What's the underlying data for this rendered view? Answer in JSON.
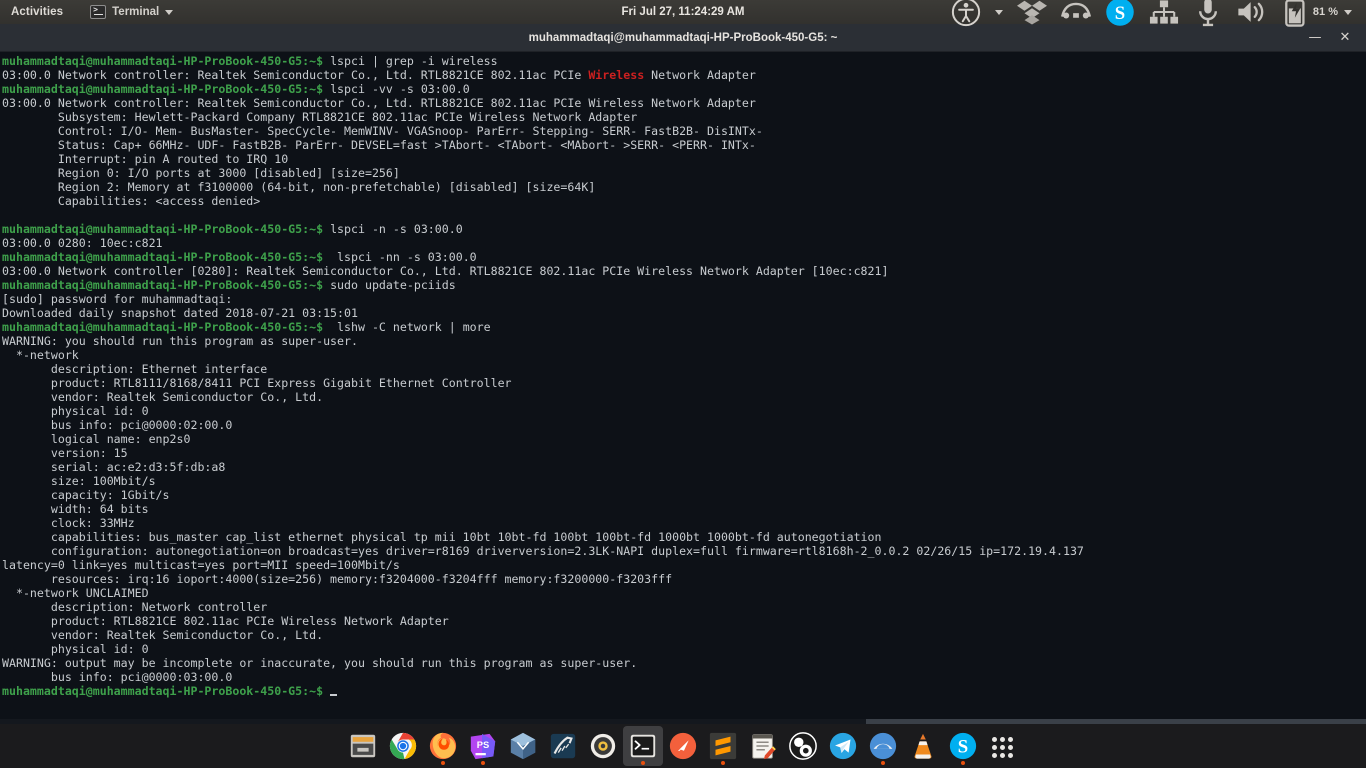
{
  "topbar": {
    "activities": "Activities",
    "app_name": "Terminal",
    "app_icon": "terminal-icon",
    "clock": "Fri Jul 27, 11:24:29 AM",
    "indicators": [
      {
        "name": "accessibility-icon",
        "label": ""
      },
      {
        "name": "chevron-down-icon",
        "label": ""
      },
      {
        "name": "dropbox-icon",
        "label": ""
      },
      {
        "name": "vpn-icon",
        "label": ""
      },
      {
        "name": "skype-tray-icon",
        "label": ""
      },
      {
        "name": "network-wired-icon",
        "label": ""
      },
      {
        "name": "microphone-icon",
        "label": ""
      },
      {
        "name": "volume-icon",
        "label": ""
      },
      {
        "name": "battery-icon",
        "label": ""
      }
    ],
    "battery_percent": "81 %"
  },
  "window": {
    "title": "muhammadtaqi@muhammadtaqi-HP-ProBook-450-G5: ~",
    "minimize_label": "—",
    "close_label": "✕"
  },
  "terminal": {
    "prompt": "muhammadtaqi@muhammadtaqi-HP-ProBook-450-G5:~$",
    "colors": {
      "background": "#0d1117",
      "foreground": "#c8ccd0",
      "prompt_green": "#3ea14b",
      "match_red": "#cc2020"
    },
    "lines": [
      {
        "type": "prompt",
        "cmd": " lspci | grep -i wireless"
      },
      {
        "type": "match",
        "pre": "03:00.0 Network controller: Realtek Semiconductor Co., Ltd. RTL8821CE 802.11ac PCIe ",
        "hit": "Wireless",
        "post": " Network Adapter"
      },
      {
        "type": "prompt",
        "cmd": " lspci -vv -s 03:00.0"
      },
      {
        "type": "out",
        "text": "03:00.0 Network controller: Realtek Semiconductor Co., Ltd. RTL8821CE 802.11ac PCIe Wireless Network Adapter"
      },
      {
        "type": "out",
        "text": "        Subsystem: Hewlett-Packard Company RTL8821CE 802.11ac PCIe Wireless Network Adapter"
      },
      {
        "type": "out",
        "text": "        Control: I/O- Mem- BusMaster- SpecCycle- MemWINV- VGASnoop- ParErr- Stepping- SERR- FastB2B- DisINTx-"
      },
      {
        "type": "out",
        "text": "        Status: Cap+ 66MHz- UDF- FastB2B- ParErr- DEVSEL=fast >TAbort- <TAbort- <MAbort- >SERR- <PERR- INTx-"
      },
      {
        "type": "out",
        "text": "        Interrupt: pin A routed to IRQ 10"
      },
      {
        "type": "out",
        "text": "        Region 0: I/O ports at 3000 [disabled] [size=256]"
      },
      {
        "type": "out",
        "text": "        Region 2: Memory at f3100000 (64-bit, non-prefetchable) [disabled] [size=64K]"
      },
      {
        "type": "out",
        "text": "        Capabilities: <access denied>"
      },
      {
        "type": "out",
        "text": ""
      },
      {
        "type": "prompt",
        "cmd": " lspci -n -s 03:00.0"
      },
      {
        "type": "out",
        "text": "03:00.0 0280: 10ec:c821"
      },
      {
        "type": "prompt",
        "cmd": "  lspci -nn -s 03:00.0"
      },
      {
        "type": "out",
        "text": "03:00.0 Network controller [0280]: Realtek Semiconductor Co., Ltd. RTL8821CE 802.11ac PCIe Wireless Network Adapter [10ec:c821]"
      },
      {
        "type": "prompt",
        "cmd": " sudo update-pciids"
      },
      {
        "type": "out",
        "text": "[sudo] password for muhammadtaqi:"
      },
      {
        "type": "out",
        "text": "Downloaded daily snapshot dated 2018-07-21 03:15:01"
      },
      {
        "type": "prompt",
        "cmd": "  lshw -C network | more"
      },
      {
        "type": "out",
        "text": "WARNING: you should run this program as super-user."
      },
      {
        "type": "out",
        "text": "  *-network"
      },
      {
        "type": "out",
        "text": "       description: Ethernet interface"
      },
      {
        "type": "out",
        "text": "       product: RTL8111/8168/8411 PCI Express Gigabit Ethernet Controller"
      },
      {
        "type": "out",
        "text": "       vendor: Realtek Semiconductor Co., Ltd."
      },
      {
        "type": "out",
        "text": "       physical id: 0"
      },
      {
        "type": "out",
        "text": "       bus info: pci@0000:02:00.0"
      },
      {
        "type": "out",
        "text": "       logical name: enp2s0"
      },
      {
        "type": "out",
        "text": "       version: 15"
      },
      {
        "type": "out",
        "text": "       serial: ac:e2:d3:5f:db:a8"
      },
      {
        "type": "out",
        "text": "       size: 100Mbit/s"
      },
      {
        "type": "out",
        "text": "       capacity: 1Gbit/s"
      },
      {
        "type": "out",
        "text": "       width: 64 bits"
      },
      {
        "type": "out",
        "text": "       clock: 33MHz"
      },
      {
        "type": "out",
        "text": "       capabilities: bus_master cap_list ethernet physical tp mii 10bt 10bt-fd 100bt 100bt-fd 1000bt 1000bt-fd autonegotiation"
      },
      {
        "type": "out",
        "text": "       configuration: autonegotiation=on broadcast=yes driver=r8169 driverversion=2.3LK-NAPI duplex=full firmware=rtl8168h-2_0.0.2 02/26/15 ip=172.19.4.137"
      },
      {
        "type": "out",
        "text": "latency=0 link=yes multicast=yes port=MII speed=100Mbit/s"
      },
      {
        "type": "out",
        "text": "       resources: irq:16 ioport:4000(size=256) memory:f3204000-f3204fff memory:f3200000-f3203fff"
      },
      {
        "type": "out",
        "text": "  *-network UNCLAIMED"
      },
      {
        "type": "out",
        "text": "       description: Network controller"
      },
      {
        "type": "out",
        "text": "       product: RTL8821CE 802.11ac PCIe Wireless Network Adapter"
      },
      {
        "type": "out",
        "text": "       vendor: Realtek Semiconductor Co., Ltd."
      },
      {
        "type": "out",
        "text": "       physical id: 0"
      },
      {
        "type": "out",
        "text": "WARNING: output may be incomplete or inaccurate, you should run this program as super-user."
      },
      {
        "type": "out",
        "text": "       bus info: pci@0000:03:00.0"
      },
      {
        "type": "cursor",
        "cmd": " "
      }
    ]
  },
  "dock": {
    "items": [
      {
        "name": "files-icon",
        "label": "Files",
        "running": false,
        "active": false
      },
      {
        "name": "chrome-icon",
        "label": "Google Chrome",
        "running": false,
        "active": false
      },
      {
        "name": "firefox-icon",
        "label": "Firefox",
        "running": true,
        "active": false
      },
      {
        "name": "phpstorm-icon",
        "label": "PhpStorm",
        "running": true,
        "active": false
      },
      {
        "name": "virtualbox-icon",
        "label": "VirtualBox",
        "running": false,
        "active": false
      },
      {
        "name": "mysql-workbench-icon",
        "label": "MySQL Workbench",
        "running": false,
        "active": false
      },
      {
        "name": "settings-icon",
        "label": "Settings",
        "running": false,
        "active": false
      },
      {
        "name": "terminal-icon",
        "label": "Terminal",
        "running": true,
        "active": true
      },
      {
        "name": "postman-icon",
        "label": "Postman",
        "running": false,
        "active": false
      },
      {
        "name": "sublime-text-icon",
        "label": "Sublime Text",
        "running": true,
        "active": false
      },
      {
        "name": "notes-icon",
        "label": "Notes",
        "running": false,
        "active": false
      },
      {
        "name": "obs-icon",
        "label": "OBS Studio",
        "running": false,
        "active": false
      },
      {
        "name": "telegram-icon",
        "label": "Telegram",
        "running": false,
        "active": false
      },
      {
        "name": "zoom-icon",
        "label": "Zoom",
        "running": true,
        "active": false
      },
      {
        "name": "vlc-icon",
        "label": "VLC",
        "running": false,
        "active": false
      },
      {
        "name": "skype-icon",
        "label": "Skype",
        "running": true,
        "active": false
      },
      {
        "name": "show-apps-icon",
        "label": "Show Applications",
        "running": false,
        "active": false
      }
    ]
  }
}
